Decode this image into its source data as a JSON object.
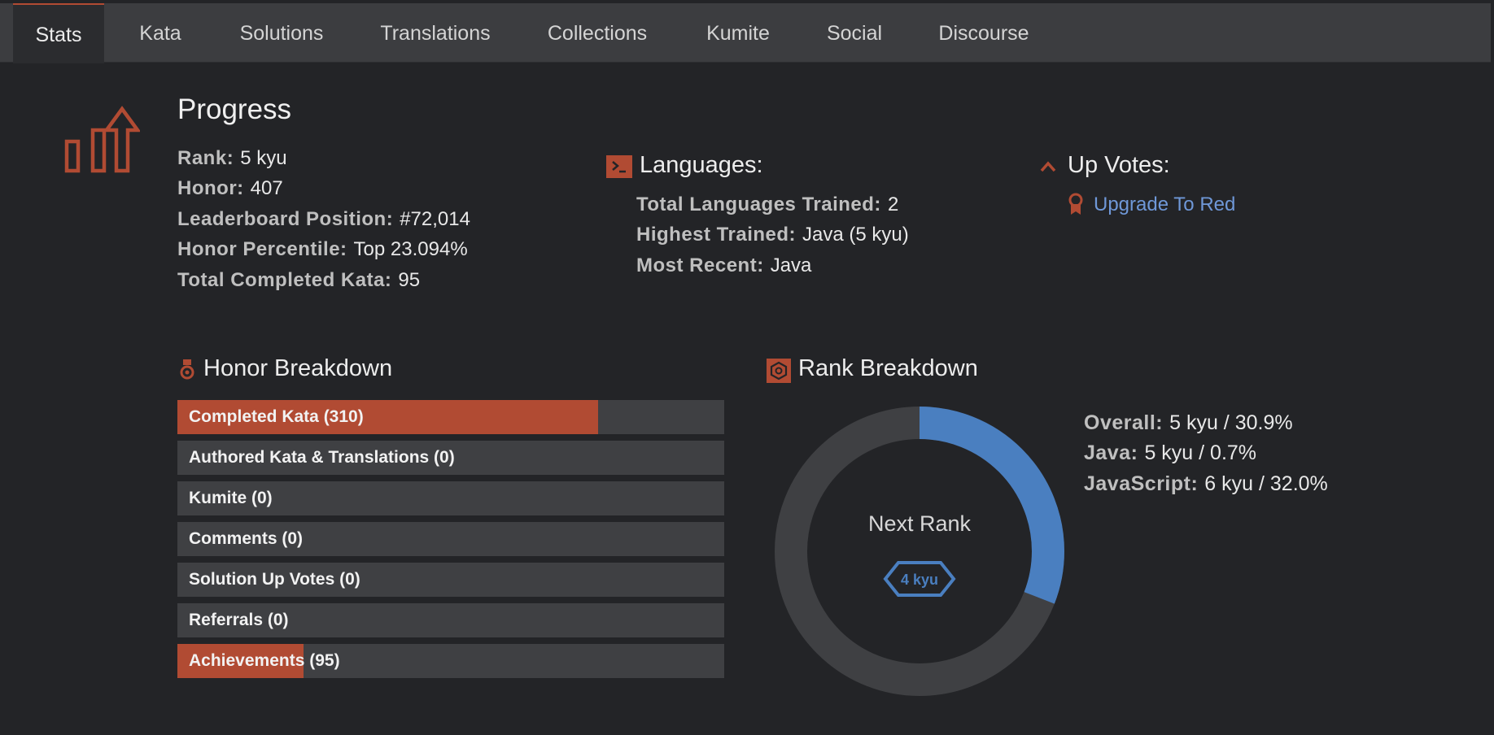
{
  "tabs": [
    {
      "label": "Stats",
      "active": true
    },
    {
      "label": "Kata",
      "active": false
    },
    {
      "label": "Solutions",
      "active": false
    },
    {
      "label": "Translations",
      "active": false
    },
    {
      "label": "Collections",
      "active": false
    },
    {
      "label": "Kumite",
      "active": false
    },
    {
      "label": "Social",
      "active": false
    },
    {
      "label": "Discourse",
      "active": false
    }
  ],
  "progress": {
    "title": "Progress",
    "icon": "bar-chart-up-icon",
    "rows": [
      {
        "label": "Rank:",
        "value": "5 kyu"
      },
      {
        "label": "Honor:",
        "value": "407"
      },
      {
        "label": "Leaderboard Position:",
        "value": "#72,014"
      },
      {
        "label": "Honor Percentile:",
        "value": "Top 23.094%"
      },
      {
        "label": "Total Completed Kata:",
        "value": "95"
      }
    ]
  },
  "languages": {
    "title": "Languages:",
    "icon": "terminal-icon",
    "rows": [
      {
        "label": "Total Languages Trained:",
        "value": "2"
      },
      {
        "label": "Highest Trained:",
        "value": "Java (5 kyu)"
      },
      {
        "label": "Most Recent:",
        "value": "Java"
      }
    ]
  },
  "upvotes": {
    "title": "Up Votes:",
    "icon": "chevron-up-icon",
    "link_icon": "ribbon-award-icon",
    "link": "Upgrade To Red"
  },
  "honor_breakdown": {
    "title": "Honor Breakdown",
    "icon": "medal-icon",
    "bars": [
      {
        "label": "Completed Kata (310)",
        "fill": 0.77
      },
      {
        "label": "Authored Kata & Translations (0)",
        "fill": 0
      },
      {
        "label": "Kumite (0)",
        "fill": 0
      },
      {
        "label": "Comments (0)",
        "fill": 0
      },
      {
        "label": "Solution Up Votes (0)",
        "fill": 0
      },
      {
        "label": "Referrals (0)",
        "fill": 0
      },
      {
        "label": "Achievements (95)",
        "fill": 0.23
      }
    ]
  },
  "rank_breakdown": {
    "title": "Rank Breakdown",
    "icon": "hexagon-badge-icon",
    "progress_fraction": 0.309,
    "next_rank_label": "Next Rank",
    "next_rank_value": "4 kyu",
    "rows": [
      {
        "label": "Overall:",
        "value": "5 kyu / 30.9%"
      },
      {
        "label": "Java:",
        "value": "5 kyu / 0.7%"
      },
      {
        "label": "JavaScript:",
        "value": "6 kyu / 32.0%"
      }
    ]
  },
  "colors": {
    "accent": "#b14b33",
    "link": "#6f98d8",
    "ring_progress": "#4a7fc0",
    "ring_track": "#3f4043",
    "background": "#232427"
  }
}
